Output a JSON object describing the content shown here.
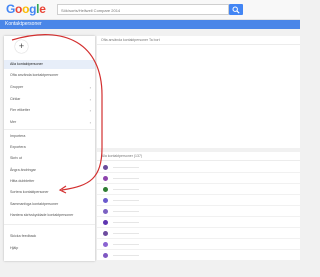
{
  "app": {
    "logo": "Google",
    "search_placeholder": "Sök/sorts/Hellwell Compare 2014",
    "search_icon": "search-icon",
    "title": "Kontaktpersoner",
    "accent_color": "#4a86e8",
    "logo_colors": [
      "#4285f4",
      "#ea4335",
      "#fbbc05",
      "#4285f4",
      "#34a853",
      "#ea4335"
    ]
  },
  "sidebar": {
    "avatar_icon": "plus-icon",
    "add_symbol": "+",
    "items": [
      {
        "label": "Alla kontaktpersoner",
        "active": true
      },
      {
        "label": "Ofta använda kontaktpersoner"
      },
      {
        "label": "Grupper",
        "chevron": "›"
      },
      {
        "label": "Cirklar",
        "chevron": "›"
      },
      {
        "label": "Fler etiketter",
        "chevron": "›"
      },
      {
        "label": "Mer",
        "chevron": "›"
      },
      {
        "label": "Importera"
      },
      {
        "label": "Exportera"
      },
      {
        "label": "Skriv ut"
      },
      {
        "label": "Ångra ändringar"
      },
      {
        "label": "Hitta dubbletter"
      },
      {
        "label": "Sortera kontaktpersoner"
      },
      {
        "label": "Sammanfoga kontaktpersoner"
      },
      {
        "label": "Hantera skrivskyddade kontaktpersoner"
      },
      {
        "label": "Skicka feedback"
      },
      {
        "label": "Hjälp"
      }
    ]
  },
  "panels": {
    "top_header": "Ofta använda kontaktpersoner  Ta bort",
    "bottom_header": "Alla kontaktpersoner (137)"
  },
  "contacts": {
    "dot_colors": [
      "#6a4c9c",
      "#8e44ad",
      "#2e7d32",
      "#6a5acd",
      "#7b61c2",
      "#5e35b1",
      "#6d4c9f",
      "#8a63d2",
      "#7e57c2"
    ]
  }
}
